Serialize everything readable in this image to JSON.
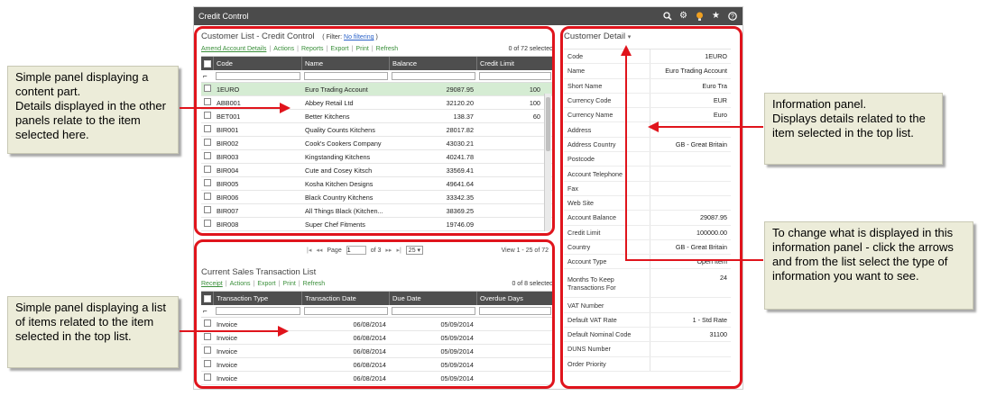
{
  "app": {
    "title": "Credit Control",
    "icons": [
      "search-settings-icon",
      "gear-icon",
      "lightbulb-icon",
      "star-icon",
      "help-icon"
    ]
  },
  "customer_list": {
    "title": "Customer List - Credit Control",
    "filter_prefix": "( Filter:",
    "filter_link": "No filtering",
    "filter_suffix": ")",
    "toolbar": [
      "Amend Account Details",
      "Actions",
      "Reports",
      "Export",
      "Print",
      "Refresh"
    ],
    "count": "0 of 72 selected",
    "columns": [
      "Code",
      "Name",
      "Balance",
      "Credit Limit"
    ],
    "rows": [
      {
        "code": "1EURO",
        "name": "Euro Trading Account",
        "balance": "29087.95",
        "limit": "100",
        "selected": true
      },
      {
        "code": "ABB001",
        "name": "Abbey Retail Ltd",
        "balance": "32120.20",
        "limit": "100"
      },
      {
        "code": "BET001",
        "name": "Better Kitchens",
        "balance": "138.37",
        "limit": "60"
      },
      {
        "code": "BIR001",
        "name": "Quality Counts Kitchens",
        "balance": "28017.82",
        "limit": ""
      },
      {
        "code": "BIR002",
        "name": "Cook's Cookers Company",
        "balance": "43030.21",
        "limit": ""
      },
      {
        "code": "BIR003",
        "name": "Kingstanding Kitchens",
        "balance": "40241.78",
        "limit": ""
      },
      {
        "code": "BIR004",
        "name": "Cute and Cosey Kitsch",
        "balance": "33569.41",
        "limit": ""
      },
      {
        "code": "BIR005",
        "name": "Kosha Kitchen Designs",
        "balance": "49641.64",
        "limit": ""
      },
      {
        "code": "BIR006",
        "name": "Black Country Kitchens",
        "balance": "33342.35",
        "limit": ""
      },
      {
        "code": "BIR007",
        "name": "All Things Black (Kitchen...",
        "balance": "38369.25",
        "limit": ""
      },
      {
        "code": "BIR008",
        "name": "Super Chef Fitments",
        "balance": "19746.09",
        "limit": ""
      }
    ],
    "pager": {
      "page_label": "Page",
      "page_value": "1",
      "of_pages": "of 3",
      "page_size": "25",
      "view_text": "View 1 - 25 of 72"
    }
  },
  "transactions": {
    "title": "Current Sales Transaction List",
    "toolbar": [
      "Receipt",
      "Actions",
      "Export",
      "Print",
      "Refresh"
    ],
    "count": "0 of 8 selected",
    "columns": [
      "Transaction Type",
      "Transaction Date",
      "Due Date",
      "Overdue Days"
    ],
    "rows": [
      {
        "type": "Invoice",
        "date": "06/08/2014",
        "due": "05/09/2014"
      },
      {
        "type": "Invoice",
        "date": "06/08/2014",
        "due": "05/09/2014"
      },
      {
        "type": "Invoice",
        "date": "06/08/2014",
        "due": "05/09/2014"
      },
      {
        "type": "Invoice",
        "date": "06/08/2014",
        "due": "05/09/2014"
      },
      {
        "type": "Invoice",
        "date": "06/08/2014",
        "due": "05/09/2014"
      }
    ]
  },
  "detail": {
    "title": "Customer Detail",
    "fields": [
      {
        "label": "Code",
        "value": "1EURO"
      },
      {
        "label": "Name",
        "value": "Euro Trading Account"
      },
      {
        "label": "Short Name",
        "value": "Euro Tra"
      },
      {
        "label": "Currency Code",
        "value": "EUR"
      },
      {
        "label": "Currency Name",
        "value": "Euro"
      },
      {
        "label": "Address",
        "value": ""
      },
      {
        "label": "Address Country",
        "value": "GB - Great Britain"
      },
      {
        "label": "Postcode",
        "value": ""
      },
      {
        "label": "Account Telephone",
        "value": ""
      },
      {
        "label": "Fax",
        "value": ""
      },
      {
        "label": "Web Site",
        "value": ""
      },
      {
        "label": "Account Balance",
        "value": "29087.95"
      },
      {
        "label": "Credit Limit",
        "value": "100000.00"
      },
      {
        "label": "Country",
        "value": "GB - Great Britain"
      },
      {
        "label": "Account Type",
        "value": "Open Item"
      },
      {
        "label": "Months To Keep Transactions For",
        "value": "24"
      },
      {
        "label": "VAT Number",
        "value": ""
      },
      {
        "label": "Default VAT Rate",
        "value": "1 - Std Rate"
      },
      {
        "label": "Default Nominal Code",
        "value": "31100"
      },
      {
        "label": "DUNS Number",
        "value": ""
      },
      {
        "label": "Order Priority",
        "value": ""
      }
    ]
  },
  "callouts": {
    "left_top": "Simple panel displaying a content part.\nDetails displayed in the other panels relate to the item selected here.",
    "left_bottom": "Simple panel displaying a list of items related to the item selected in the top list.",
    "right_top": "Information panel.\nDisplays details related to the item  selected in the top list.",
    "right_bottom": "To change what is displayed in this information panel - click the arrows and from the list select the type of information you want to see."
  },
  "colors": {
    "highlight": "#e0141c",
    "selected_row": "#d5ecd3",
    "link_green": "#3a8f3a",
    "header_dark": "#4e4e4e",
    "callout_bg": "#ececd9"
  }
}
